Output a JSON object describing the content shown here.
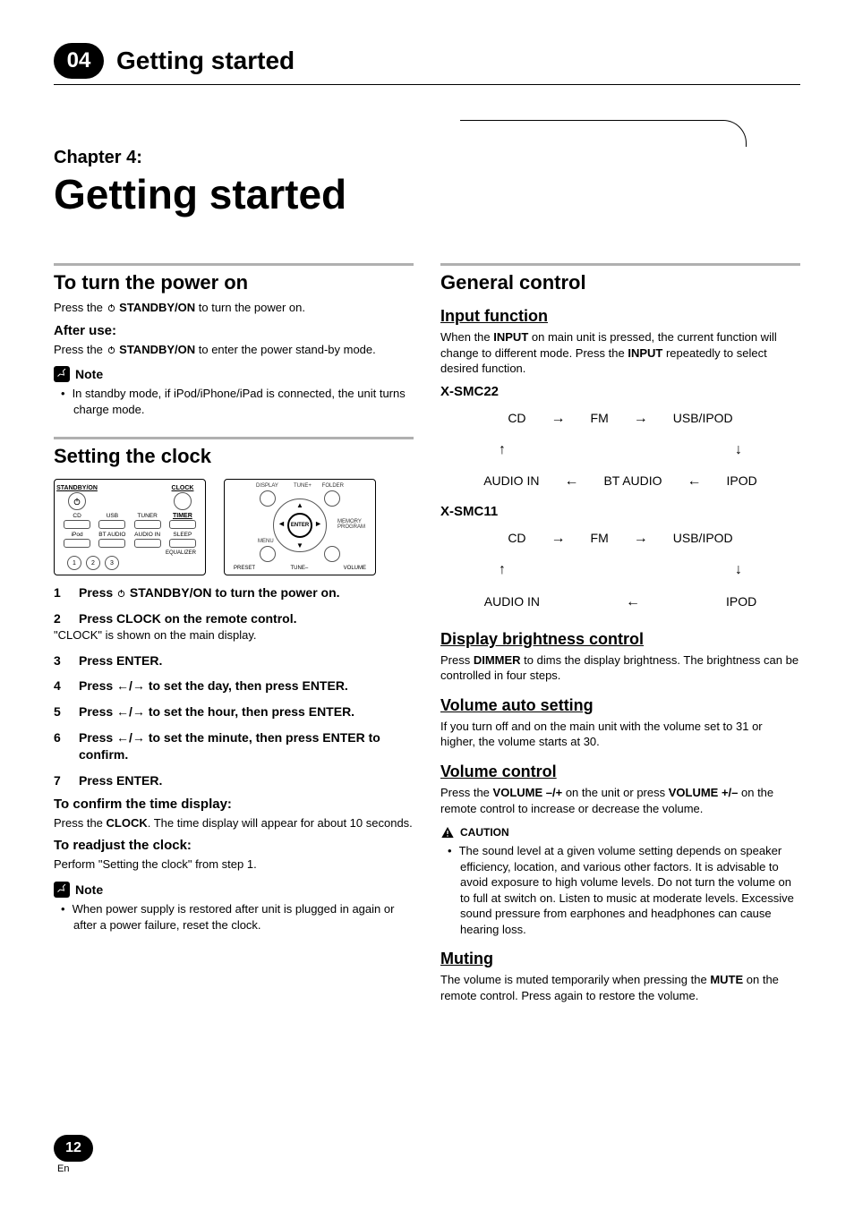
{
  "header": {
    "chapter_number": "04",
    "running_title": "Getting started",
    "chapter_label": "Chapter 4:",
    "page_title": "Getting started"
  },
  "left": {
    "power": {
      "title": "To turn the power on",
      "line1_pre": "Press the ",
      "line1_btn": "STANDBY/ON",
      "line1_post": " to turn the power on.",
      "after_use": "After use:",
      "line2_pre": "Press the ",
      "line2_btn": "STANDBY/ON",
      "line2_post": " to enter the power stand-by mode.",
      "note_label": "Note",
      "note_item": "In standby mode, if iPod/iPhone/iPad is connected, the unit turns charge mode."
    },
    "clock": {
      "title": "Setting the clock",
      "remote_a": {
        "standby": "STANDBY/ON",
        "clock": "CLOCK",
        "cd": "CD",
        "usb": "USB",
        "tuner": "TUNER",
        "timer": "TIMER",
        "ipod": "iPod",
        "btaudio": "BT AUDIO",
        "audioin": "AUDIO IN",
        "sleep": "SLEEP",
        "equalizer": "EQUALIZER",
        "n1": "1",
        "n2": "2",
        "n3": "3"
      },
      "remote_b": {
        "display": "DISPLAY",
        "tunep": "TUNE+",
        "folder": "FOLDER",
        "menu": "MENU",
        "tunem": "TUNE–",
        "volume": "VOLUME",
        "preset": "PRESET",
        "memory": "MEMORY",
        "program": "PROGRAM",
        "enter": "ENTER"
      },
      "steps": {
        "s1": "Press ⁠ STANDBY/ON to turn the power on.",
        "s2": "Press CLOCK on the remote control.",
        "s2_sub": "\"CLOCK\" is shown on the main display.",
        "s3": "Press ENTER.",
        "s4": "Press ←/→ to set the day, then press ENTER.",
        "s5": "Press ←/→ to set the hour, then press ENTER.",
        "s6": "Press ←/→ to set the minute, then press ENTER to confirm.",
        "s7": "Press ENTER."
      },
      "confirm_title": "To confirm the time display:",
      "confirm_body_pre": "Press the ",
      "confirm_body_b": "CLOCK",
      "confirm_body_post": ". The time display will appear for about 10 seconds.",
      "readjust_title": "To readjust the clock:",
      "readjust_body": "Perform \"Setting the clock\" from step 1.",
      "note_label": "Note",
      "note_item": "When power supply is restored after unit is plugged in again or after a power failure, reset the clock."
    }
  },
  "right": {
    "general": {
      "title": "General control",
      "input_title": "Input function",
      "input_body_1": "When the ",
      "input_body_b1": "INPUT",
      "input_body_2": " on main unit is pressed, the current function will change to different mode. Press the ",
      "input_body_b2": "INPUT",
      "input_body_3": " repeatedly to select desired function.",
      "model_a": "X-SMC22",
      "model_b": "X-SMC11",
      "cycle_a": {
        "r1": [
          "CD",
          "FM",
          "USB/IPOD"
        ],
        "r2": [
          "AUDIO IN",
          "BT AUDIO",
          "IPOD"
        ]
      },
      "cycle_b": {
        "r1": [
          "CD",
          "FM",
          "USB/IPOD"
        ],
        "r2": [
          "AUDIO IN",
          "IPOD"
        ]
      },
      "display_title": "Display brightness control",
      "display_body_pre": "Press ",
      "display_body_b": "DIMMER",
      "display_body_post": " to dims the display brightness. The brightness can be controlled in four steps.",
      "vauto_title": "Volume auto setting",
      "vauto_body": "If you turn off and on the main unit with the volume set to 31 or higher, the volume starts at 30.",
      "vctrl_title": "Volume control",
      "vctrl_1": "Press the ",
      "vctrl_b1": "VOLUME –/+",
      "vctrl_2": " on the unit or press ",
      "vctrl_b2": "VOLUME +/–",
      "vctrl_3": " on the remote control to increase or decrease the volume.",
      "caution_label": "CAUTION",
      "caution_item": "The sound level at a given volume setting depends on speaker efficiency, location, and various other factors. It is advisable to avoid exposure to high volume levels. Do not turn the volume on to full at switch on. Listen to music at moderate levels. Excessive sound pressure from earphones and headphones can cause hearing loss.",
      "muting_title": "Muting",
      "muting_1": "The volume is muted temporarily when pressing the ",
      "muting_b": "MUTE",
      "muting_2": " on the remote control. Press again to restore the volume."
    }
  },
  "footer": {
    "page": "12",
    "lang": "En"
  }
}
